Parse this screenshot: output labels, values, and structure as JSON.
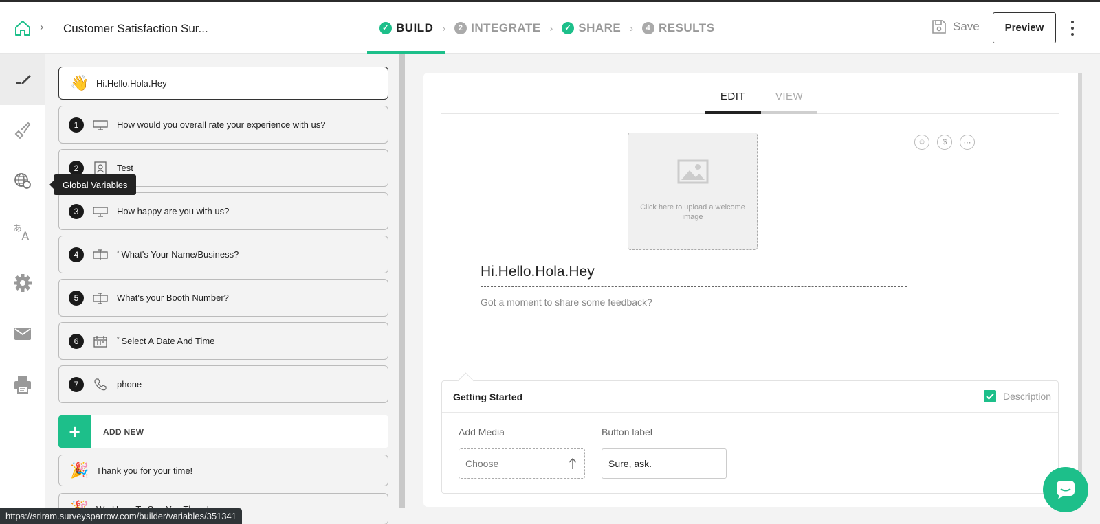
{
  "header": {
    "survey_title": "Customer Satisfaction Sur...",
    "steps": [
      {
        "label": "BUILD",
        "badge": "",
        "state": "done-active"
      },
      {
        "label": "INTEGRATE",
        "badge": "2",
        "state": "pending"
      },
      {
        "label": "SHARE",
        "badge": "",
        "state": "done"
      },
      {
        "label": "RESULTS",
        "badge": "4",
        "state": "pending"
      }
    ],
    "save_label": "Save",
    "preview_label": "Preview"
  },
  "rail": {
    "items": [
      "edit-icon",
      "paint-brush-icon",
      "globe-variables-icon",
      "translate-icon",
      "gear-icon",
      "mail-icon",
      "print-icon"
    ],
    "tooltip": "Global Variables"
  },
  "questions": {
    "welcome": {
      "text": "Hi.Hello.Hola.Hey",
      "emoji": "👋"
    },
    "items": [
      {
        "num": "1",
        "icon": "rating-icon",
        "text": "How would you overall rate your experience with us?",
        "required": false
      },
      {
        "num": "2",
        "icon": "contact-card-icon",
        "text": "Test",
        "required": false
      },
      {
        "num": "3",
        "icon": "rating-icon",
        "text": "How happy are you with us?",
        "required": false
      },
      {
        "num": "4",
        "icon": "text-input-icon",
        "text": "What's Your Name/Business?",
        "required": true
      },
      {
        "num": "5",
        "icon": "text-input-icon",
        "text": "What's your Booth Number?",
        "required": false
      },
      {
        "num": "6",
        "icon": "calendar-icon",
        "text": "Select A Date And Time",
        "required": true
      },
      {
        "num": "7",
        "icon": "phone-icon",
        "text": "phone",
        "required": false
      }
    ],
    "add_new": "ADD NEW",
    "endings": [
      {
        "emoji": "🎉",
        "text": "Thank you for your time!"
      },
      {
        "emoji": "🎉",
        "text": "We Hope To See You There!"
      }
    ],
    "required_mark": "*"
  },
  "editor": {
    "tabs": [
      "EDIT",
      "VIEW"
    ],
    "upload_text": "Click here to upload a welcome image",
    "welcome_title": "Hi.Hello.Hola.Hey",
    "welcome_subtitle": "Got a moment to share some feedback?",
    "panel": {
      "title": "Getting Started",
      "description_label": "Description",
      "add_media_label": "Add Media",
      "choose_label": "Choose",
      "button_label_label": "Button label",
      "button_label_value": "Sure, ask."
    },
    "mini_icons": [
      "smiley-icon",
      "dollar-icon",
      "more-icon"
    ]
  },
  "status_url": "https://sriram.surveysparrow.com/builder/variables/351341",
  "colors": {
    "accent": "#1dbf8a",
    "dark": "#1a1a1a"
  }
}
